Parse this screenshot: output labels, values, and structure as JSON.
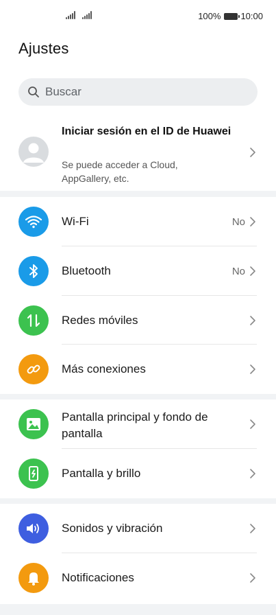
{
  "status_bar": {
    "battery": "100%",
    "time": "10:00"
  },
  "header": {
    "title": "Ajustes"
  },
  "search": {
    "placeholder": "Buscar",
    "icon": "search-icon"
  },
  "account": {
    "title": "Iniciar sesión en el ID de Huawei",
    "subtitle": "Se puede acceder a Cloud, AppGallery, etc.",
    "icon": "avatar-icon"
  },
  "groups": [
    {
      "items": [
        {
          "label": "Wi-Fi",
          "value": "No",
          "icon": "wifi-icon",
          "color": "#1a9be8"
        },
        {
          "label": "Bluetooth",
          "value": "No",
          "icon": "bluetooth-icon",
          "color": "#1a9be8"
        },
        {
          "label": "Redes móviles",
          "value": "",
          "icon": "mobile-data-icon",
          "color": "#3cc24f"
        },
        {
          "label": "Más conexiones",
          "value": "",
          "icon": "link-icon",
          "color": "#f39a0f"
        }
      ]
    },
    {
      "items": [
        {
          "label": "Pantalla principal y fondo de pantalla",
          "value": "",
          "icon": "wallpaper-icon",
          "color": "#3cc24f"
        },
        {
          "label": "Pantalla y brillo",
          "value": "",
          "icon": "display-brightness-icon",
          "color": "#3cc24f"
        }
      ]
    },
    {
      "items": [
        {
          "label": "Sonidos y vibración",
          "value": "",
          "icon": "speaker-icon",
          "color": "#3e5ee0"
        },
        {
          "label": "Notificaciones",
          "value": "",
          "icon": "bell-icon",
          "color": "#f39a0f"
        }
      ]
    }
  ]
}
